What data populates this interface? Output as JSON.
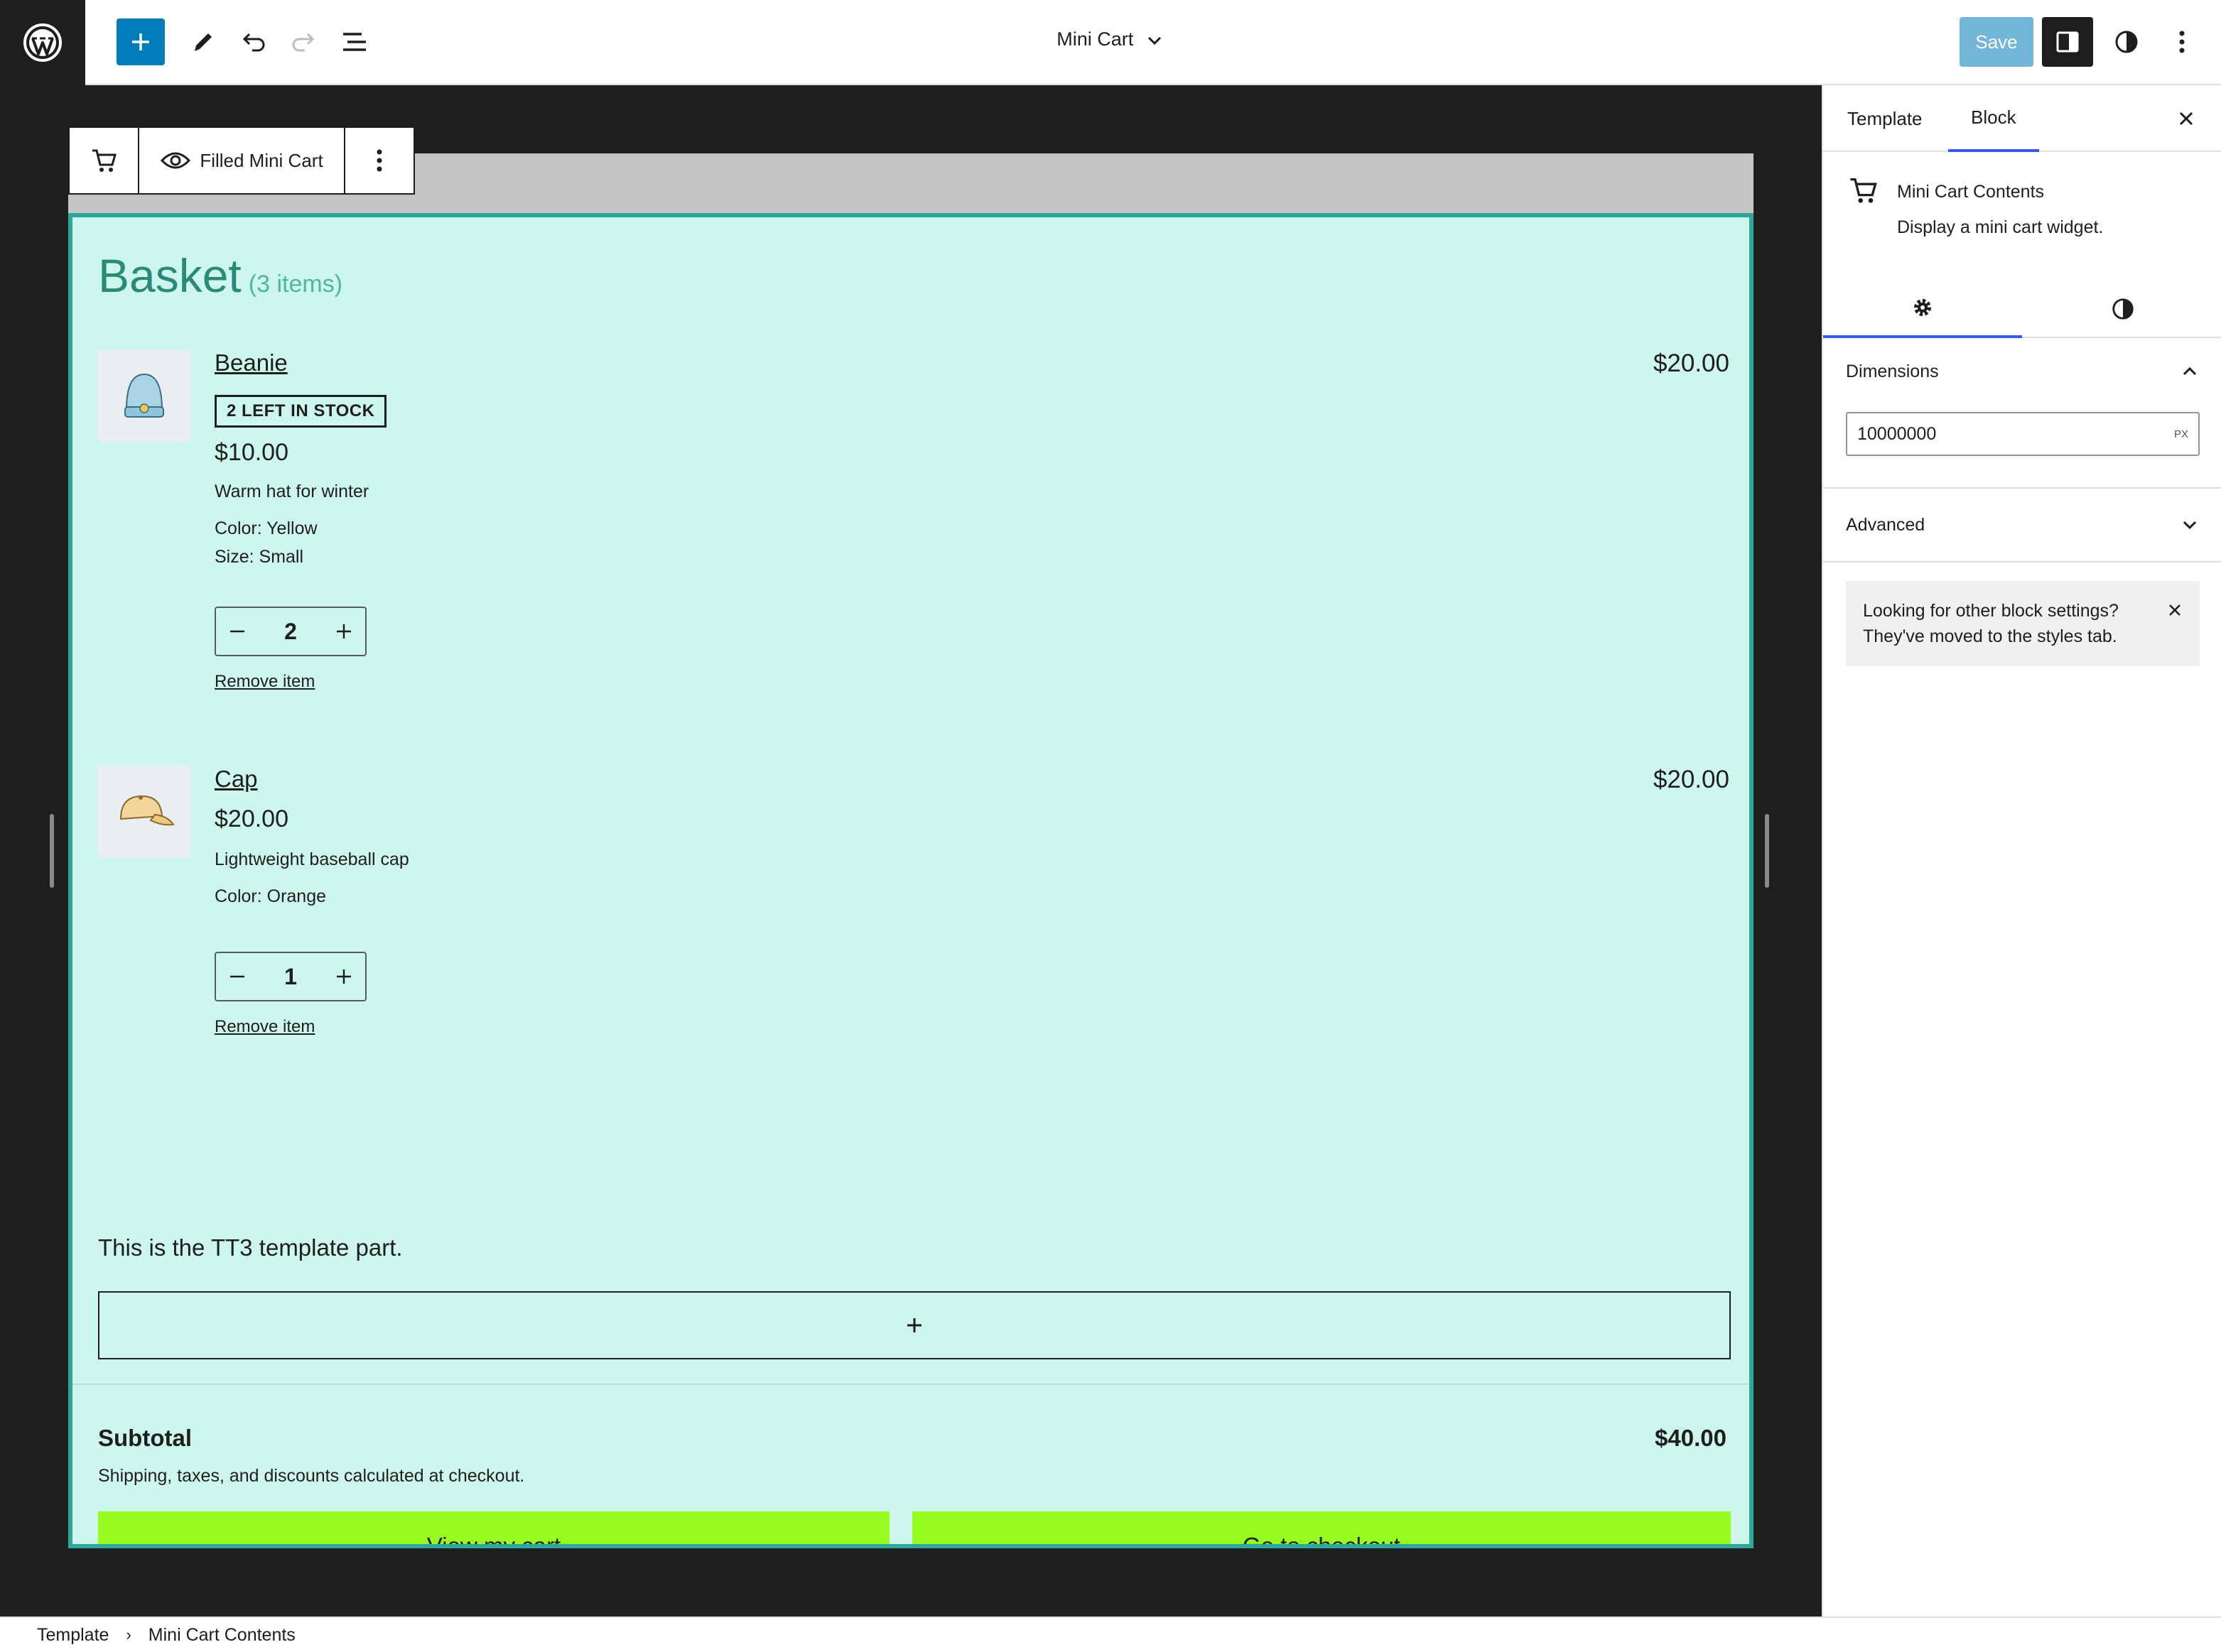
{
  "topbar": {
    "title": "Mini Cart",
    "save_label": "Save"
  },
  "block_toolbar": {
    "view_label": "Filled Mini Cart"
  },
  "cart": {
    "title": "Basket",
    "count_label": "(3 items)",
    "items": [
      {
        "name": "Beanie",
        "stock_badge": "2 LEFT IN STOCK",
        "price": "$10.00",
        "line_total": "$20.00",
        "description": "Warm hat for winter",
        "meta": [
          "Color: Yellow",
          "Size: Small"
        ],
        "quantity": "2",
        "remove_label": "Remove item"
      },
      {
        "name": "Cap",
        "price": "$20.00",
        "line_total": "$20.00",
        "description": "Lightweight baseball cap",
        "meta": [
          "Color: Orange"
        ],
        "quantity": "1",
        "remove_label": "Remove item"
      }
    ],
    "template_part_text": "This is the TT3 template part.",
    "subtotal_label": "Subtotal",
    "subtotal_value": "$40.00",
    "shipping_note": "Shipping, taxes, and discounts calculated at checkout.",
    "view_cart_label": "View my cart",
    "checkout_label": "Go to checkout",
    "button_color": "#97fd20",
    "background_color": "#cdf7ec",
    "title_color": "#2a8a77"
  },
  "sidebar": {
    "tabs": [
      "Template",
      "Block"
    ],
    "active_tab": "Block",
    "block_title": "Mini Cart Contents",
    "block_description": "Display a mini cart widget.",
    "dimensions_label": "Dimensions",
    "dimensions_value": "10000000",
    "dimensions_unit": "PX",
    "advanced_label": "Advanced",
    "notice_line1": "Looking for other block settings?",
    "notice_line2": "They've moved to the styles tab."
  },
  "breadcrumb": {
    "items": [
      "Template",
      "Mini Cart Contents"
    ]
  },
  "icons": {
    "logo": "wordpress-logo",
    "add": "plus-icon",
    "tools": "pencil-icon",
    "undo": "undo-icon",
    "redo": "redo-icon",
    "list_view": "list-view-icon",
    "settings": "sidebar-toggle-icon",
    "styles": "contrast-icon",
    "options": "more-vertical-icon"
  },
  "colors": {
    "accent": "#007cba",
    "tab_indicator": "#3858e9",
    "block_outline": "#2ea79a"
  }
}
